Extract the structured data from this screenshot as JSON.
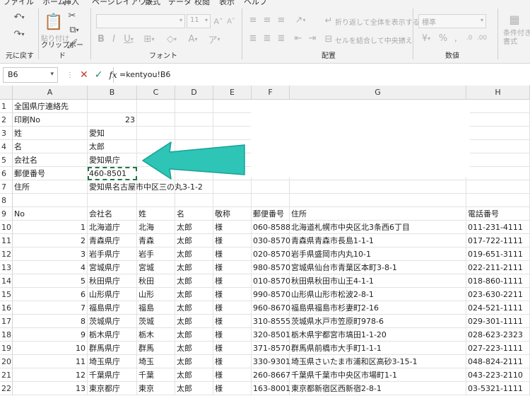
{
  "menu": [
    "ファイル",
    "ホーム",
    "挿入",
    "ページレイアウト",
    "数式",
    "データ",
    "校閲",
    "表示",
    "ヘルプ"
  ],
  "ribbon": {
    "undo_label": "元に戻す",
    "clipboard_label": "クリップボード",
    "paste_label": "貼り付け",
    "font_label": "フォント",
    "font_size": "11",
    "align_label": "配置",
    "wrap_label": "折り返して全体を表示する",
    "merge_label": "セルを結合して中央揃え",
    "number_label": "数値",
    "number_format": "標準",
    "cond_label": "条件付き書式"
  },
  "formula_bar": {
    "name_box": "B6",
    "formula": "=kentyou!B6"
  },
  "columns": [
    "A",
    "B",
    "C",
    "D",
    "E",
    "F",
    "G",
    "H"
  ],
  "rows": [
    {
      "n": "1",
      "a": "全国県庁連絡先"
    },
    {
      "n": "2",
      "a": "印刷No",
      "b": "23"
    },
    {
      "n": "3",
      "a": "姓",
      "b": "愛知"
    },
    {
      "n": "4",
      "a": "名",
      "b": "太郎"
    },
    {
      "n": "5",
      "a": "会社名",
      "b": "愛知県庁"
    },
    {
      "n": "6",
      "a": "郵便番号",
      "b": "460-8501"
    },
    {
      "n": "7",
      "a": "住所",
      "b": "愛知県名古屋市中区三の丸3-1-2"
    },
    {
      "n": "8"
    },
    {
      "n": "9",
      "a": "No",
      "b": "会社名",
      "c": "姓",
      "d": "名",
      "e": "敬称",
      "f": "郵便番号",
      "g": "住所",
      "h": "電話番号"
    },
    {
      "n": "10",
      "a": "1",
      "b": "北海道庁",
      "c": "北海",
      "d": "太郎",
      "e": "様",
      "f": "060-8588",
      "g": "北海道札幌市中央区北3条西6丁目",
      "h": "011-231-4111"
    },
    {
      "n": "11",
      "a": "2",
      "b": "青森県庁",
      "c": "青森",
      "d": "太郎",
      "e": "様",
      "f": "030-8570",
      "g": "青森県青森市長島1-1-1",
      "h": "017-722-1111"
    },
    {
      "n": "12",
      "a": "3",
      "b": "岩手県庁",
      "c": "岩手",
      "d": "太郎",
      "e": "様",
      "f": "020-8570",
      "g": "岩手県盛岡市内丸10-1",
      "h": "019-651-3111"
    },
    {
      "n": "13",
      "a": "4",
      "b": "宮城県庁",
      "c": "宮城",
      "d": "太郎",
      "e": "様",
      "f": "980-8570",
      "g": "宮城県仙台市青葉区本町3-8-1",
      "h": "022-211-2111"
    },
    {
      "n": "14",
      "a": "5",
      "b": "秋田県庁",
      "c": "秋田",
      "d": "太郎",
      "e": "様",
      "f": "010-8570",
      "g": "秋田県秋田市山王4-1-1",
      "h": "018-860-1111"
    },
    {
      "n": "15",
      "a": "6",
      "b": "山形県庁",
      "c": "山形",
      "d": "太郎",
      "e": "様",
      "f": "990-8570",
      "g": "山形県山形市松波2-8-1",
      "h": "023-630-2211"
    },
    {
      "n": "16",
      "a": "7",
      "b": "福島県庁",
      "c": "福島",
      "d": "太郎",
      "e": "様",
      "f": "960-8670",
      "g": "福島県福島市杉妻町2-16",
      "h": "024-521-1111"
    },
    {
      "n": "17",
      "a": "8",
      "b": "茨城県庁",
      "c": "茨城",
      "d": "太郎",
      "e": "様",
      "f": "310-8555",
      "g": "茨城県水戸市笠原町978-6",
      "h": "029-301-1111"
    },
    {
      "n": "18",
      "a": "9",
      "b": "栃木県庁",
      "c": "栃木",
      "d": "太郎",
      "e": "様",
      "f": "320-8501",
      "g": "栃木県宇都宮市塙田1-1-20",
      "h": "028-623-2323"
    },
    {
      "n": "19",
      "a": "10",
      "b": "群馬県庁",
      "c": "群馬",
      "d": "太郎",
      "e": "様",
      "f": "371-8570",
      "g": "群馬県前橋市大手町1-1-1",
      "h": "027-223-1111"
    },
    {
      "n": "20",
      "a": "11",
      "b": "埼玉県庁",
      "c": "埼玉",
      "d": "太郎",
      "e": "様",
      "f": "330-9301",
      "g": "埼玉県さいたま市浦和区高砂3-15-1",
      "h": "048-824-2111"
    },
    {
      "n": "21",
      "a": "12",
      "b": "千葉県庁",
      "c": "千葉",
      "d": "太郎",
      "e": "様",
      "f": "260-8667",
      "g": "千葉県千葉市中央区市場町1-1",
      "h": "043-223-2110"
    },
    {
      "n": "22",
      "a": "13",
      "b": "東京都庁",
      "c": "東京",
      "d": "太郎",
      "e": "様",
      "f": "163-8001",
      "g": "東京都新宿区西新宿2-8-1",
      "h": "03-5321-1111"
    }
  ],
  "colors": {
    "accent": "#217346",
    "arrow": "#2ec4b6",
    "cancel": "#c0392b",
    "confirm": "#2e8b57"
  }
}
